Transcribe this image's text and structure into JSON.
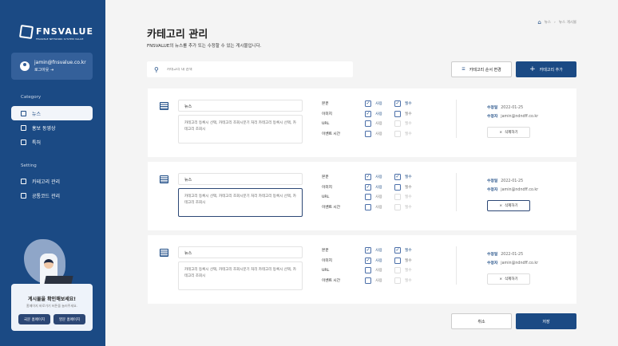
{
  "sidebar": {
    "logo": "FNSVALUE",
    "logo_sub": "FEASIBLE NETWORK SYSTEM VALUE",
    "user_email": "jamin@fnsvalue.co.kr",
    "logout": "로그아웃",
    "category_heading": "Category",
    "category_items": [
      "뉴스",
      "홍보 동영상",
      "특허"
    ],
    "setting_heading": "Setting",
    "setting_items": [
      "카테고리 관리",
      "공통코드 관리"
    ],
    "promo": {
      "title": "게시물을 확인해보세요!",
      "subtitle": "홈페이지 바로가기 버튼을 눌러주세요.",
      "btn_ko": "국문 홈페이지",
      "btn_en": "영문 홈페이지"
    }
  },
  "breadcrumb": [
    "뉴스",
    "뉴스 게시물"
  ],
  "header": {
    "title": "카테고리 관리",
    "subtitle": "FNSVALUE의 뉴스를 추가 또는 수정할 수 있는 게시물입니다."
  },
  "toolbar": {
    "search_placeholder": "카테고리 내 검색",
    "reorder_label": "카테고리 순서 변경",
    "add_label": "카테고리 추가"
  },
  "option_labels": {
    "use": "사용",
    "required": "필수"
  },
  "cards": [
    {
      "name": "뉴스",
      "desc": "카테고리 등록시 선택, 카테고리 조회시분기 처리 카테고리 등록시 선택, 카테고리 조회시",
      "options": [
        {
          "label": "본문",
          "use": true,
          "required": true
        },
        {
          "label": "이미지",
          "use": true,
          "required": false
        },
        {
          "label": "URL",
          "use": false,
          "required": false
        },
        {
          "label": "이벤트 시간",
          "use": false,
          "required": false
        }
      ],
      "modified_label": "수정일",
      "modified_date": "2022-01-25",
      "modifier_label": "수정자",
      "modifier": "jamin@ndndff.co.kr",
      "delete_label": "삭제하기"
    },
    {
      "name": "뉴스",
      "desc": "카테고리 등록시 선택, 카테고리 조회시분기 처리 카테고리 등록시 선택, 카테고리 조회시",
      "options": [
        {
          "label": "본문",
          "use": true,
          "required": true
        },
        {
          "label": "이미지",
          "use": true,
          "required": false
        },
        {
          "label": "URL",
          "use": false,
          "required": false
        },
        {
          "label": "이벤트 시간",
          "use": false,
          "required": false
        }
      ],
      "modified_label": "수정일",
      "modified_date": "2022-01-25",
      "modifier_label": "수정자",
      "modifier": "jamin@ndndff.co.kr",
      "delete_label": "삭제하기"
    },
    {
      "name": "뉴스",
      "desc": "카테고리 등록시 선택, 카테고리 조회시분기 처리 카테고리 등록시 선택, 카테고리 조회시",
      "options": [
        {
          "label": "본문",
          "use": true,
          "required": true
        },
        {
          "label": "이미지",
          "use": true,
          "required": false
        },
        {
          "label": "URL",
          "use": false,
          "required": false
        },
        {
          "label": "이벤트 시간",
          "use": false,
          "required": false
        }
      ],
      "modified_label": "수정일",
      "modified_date": "2022-01-25",
      "modifier_label": "수정자",
      "modifier": "jamin@ndndff.co.kr",
      "delete_label": "삭제하기"
    }
  ],
  "footer": {
    "cancel_label": "취소",
    "save_label": "저장"
  }
}
